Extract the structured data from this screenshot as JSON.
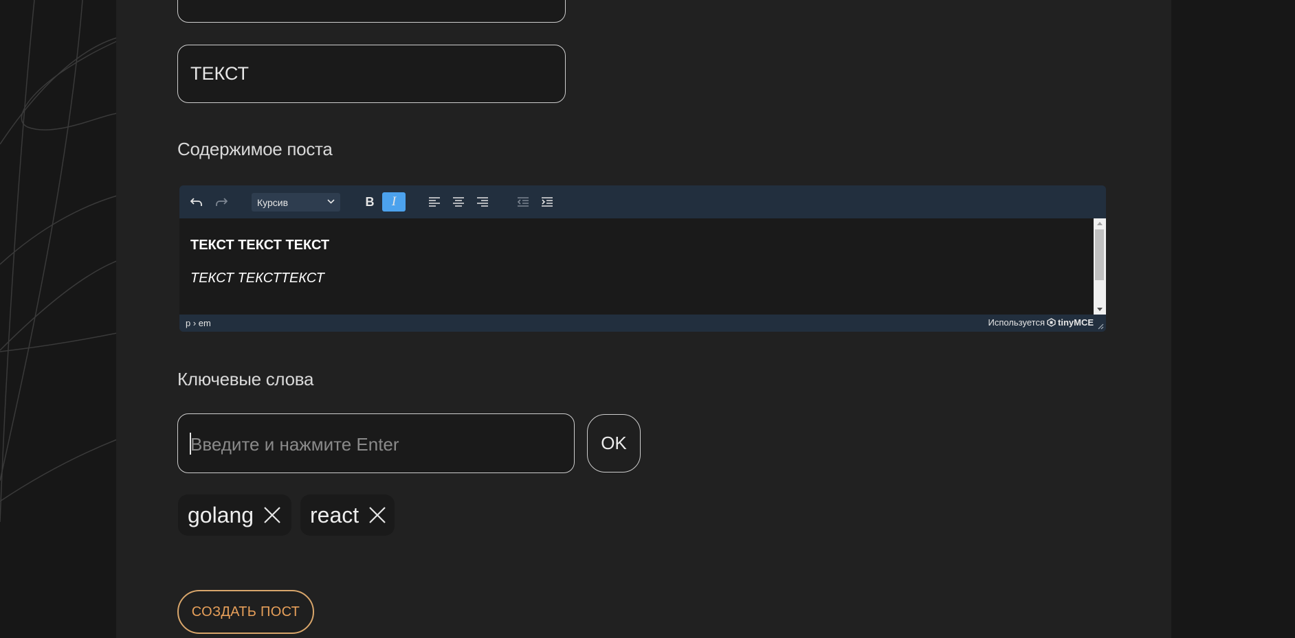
{
  "form": {
    "title_value": "ТЕКСТ",
    "content_label": "Содержимое поста",
    "keywords_label": "Ключевые слова"
  },
  "editor": {
    "toolbar": {
      "block_format": "Курсив",
      "bold_label": "B",
      "italic_label": "I",
      "italic_active": true,
      "icons": [
        "undo-icon",
        "redo-icon",
        "align-left-icon",
        "align-center-icon",
        "align-right-icon",
        "outdent-icon",
        "indent-icon"
      ]
    },
    "content": {
      "line1": "ТЕКСТ ТЕКСТ ТЕКСТ",
      "line2": "ТЕКСТ ТЕКСТТЕКСТ"
    },
    "status": {
      "path": "p › em",
      "powered_by": "Используется",
      "brand": "tinyMCE"
    }
  },
  "keywords": {
    "placeholder": "Введите и нажмите Enter",
    "ok_label": "OK",
    "tags": [
      "golang",
      "react"
    ]
  },
  "submit_label": "СОЗДАТЬ ПОСТ",
  "colors": {
    "background": "#171717",
    "panel": "#212121",
    "editor_chrome": "#222f3e",
    "active_button": "#4ca2ed",
    "submit_accent": "#e8a05a"
  }
}
